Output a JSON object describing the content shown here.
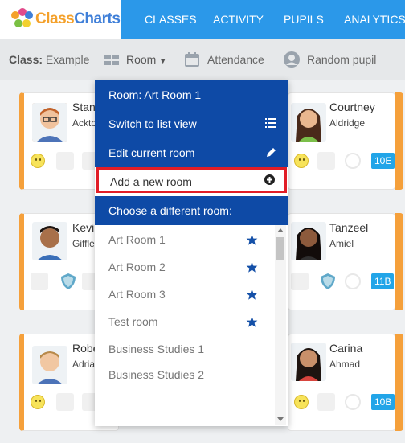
{
  "brand": {
    "logo_part1": "Class",
    "logo_part2": "Charts"
  },
  "nav": {
    "items": [
      {
        "label": "CLASSES"
      },
      {
        "label": "ACTIVITY"
      },
      {
        "label": "PUPILS"
      },
      {
        "label": "ANALYTICS"
      }
    ]
  },
  "toolbar": {
    "class_prefix": "Class:",
    "class_name": "Example",
    "room_label": "Room",
    "attendance_label": "Attendance",
    "random_label": "Random pupil"
  },
  "pupils": [
    {
      "first": "Stan",
      "last": "Ackto"
    },
    {
      "first": "Courtney",
      "last": "Aldridge",
      "badge": "10E"
    },
    {
      "first": "Kevin",
      "last": "Giffle"
    },
    {
      "first": "Tanzeel",
      "last": "Amiel",
      "badge": "11B"
    },
    {
      "first": "Robe",
      "last": "Adrian"
    },
    {
      "first": "Carina",
      "last": "Ahmad",
      "badge": "10B"
    }
  ],
  "dropdown": {
    "current_room": "Room: Art Room 1",
    "switch_view": "Switch to list view",
    "edit_room": "Edit current room",
    "add_room": "Add a new room",
    "choose_heading": "Choose a different room:",
    "rooms": [
      {
        "name": "Art Room 1",
        "starred": true
      },
      {
        "name": "Art Room 2",
        "starred": true
      },
      {
        "name": "Art Room 3",
        "starred": true
      },
      {
        "name": "Test room",
        "starred": true
      },
      {
        "name": "Business Studies 1",
        "starred": false
      },
      {
        "name": "Business Studies 2",
        "starred": false
      }
    ]
  },
  "colors": {
    "nav": "#2b98e9",
    "dropdown": "#0e4aa6",
    "highlight": "#e11d26",
    "stripe": "#f5a03b",
    "badge": "#22a5e8"
  },
  "icons": {
    "list": "list-icon",
    "edit": "pencil-icon",
    "add": "plus-circle-icon",
    "star": "star-icon",
    "room": "room-icon",
    "calendar": "calendar-icon",
    "user": "user-icon"
  }
}
